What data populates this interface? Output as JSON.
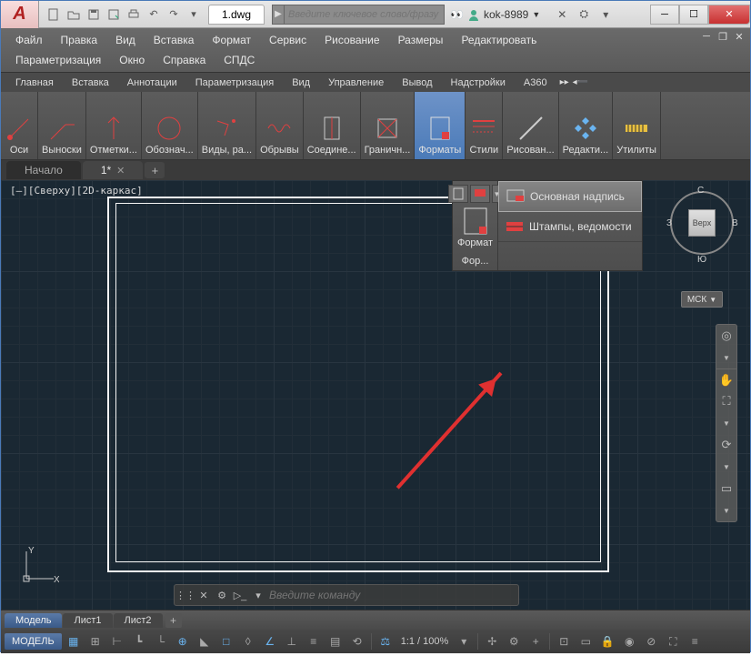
{
  "app": {
    "letter": "A",
    "doc_title": "1.dwg",
    "search_placeholder": "Введите ключевое слово/фразу",
    "username": "kok-8989"
  },
  "menubar": [
    "Файл",
    "Правка",
    "Вид",
    "Вставка",
    "Формат",
    "Сервис",
    "Рисование",
    "Размеры",
    "Редактировать",
    "Параметризация",
    "Окно",
    "Справка",
    "СПДС"
  ],
  "ribbon_tabs": [
    "Главная",
    "Вставка",
    "Аннотации",
    "Параметризация",
    "Вид",
    "Управление",
    "Вывод",
    "Надстройки",
    "A360"
  ],
  "ribbon_panels": [
    {
      "label": "Оси"
    },
    {
      "label": "Выноски"
    },
    {
      "label": "Отметки..."
    },
    {
      "label": "Обознач..."
    },
    {
      "label": "Виды, ра..."
    },
    {
      "label": "Обрывы"
    },
    {
      "label": "Соедине..."
    },
    {
      "label": "Граничн..."
    },
    {
      "label": "Форматы",
      "active": true
    },
    {
      "label": "Стили"
    },
    {
      "label": "Рисован..."
    },
    {
      "label": "Редакти..."
    },
    {
      "label": "Утилиты"
    }
  ],
  "doc_tabs": {
    "start": "Начало",
    "active": "1*"
  },
  "viewport_label": "[‒][Сверху][2D-каркас]",
  "dropdown": {
    "title": "Формат",
    "sub": "Фор...",
    "items": [
      "Основная надпись",
      "Штампы, ведомости"
    ]
  },
  "navcube": {
    "face": "Верх",
    "n": "С",
    "s": "Ю",
    "e": "В",
    "w": "З",
    "wcs": "МСК"
  },
  "command": {
    "placeholder": "Введите команду"
  },
  "sheets": {
    "model": "Модель",
    "tabs": [
      "Лист1",
      "Лист2"
    ]
  },
  "status": {
    "model": "МОДЕЛЬ",
    "scale": "1:1 / 100%"
  }
}
